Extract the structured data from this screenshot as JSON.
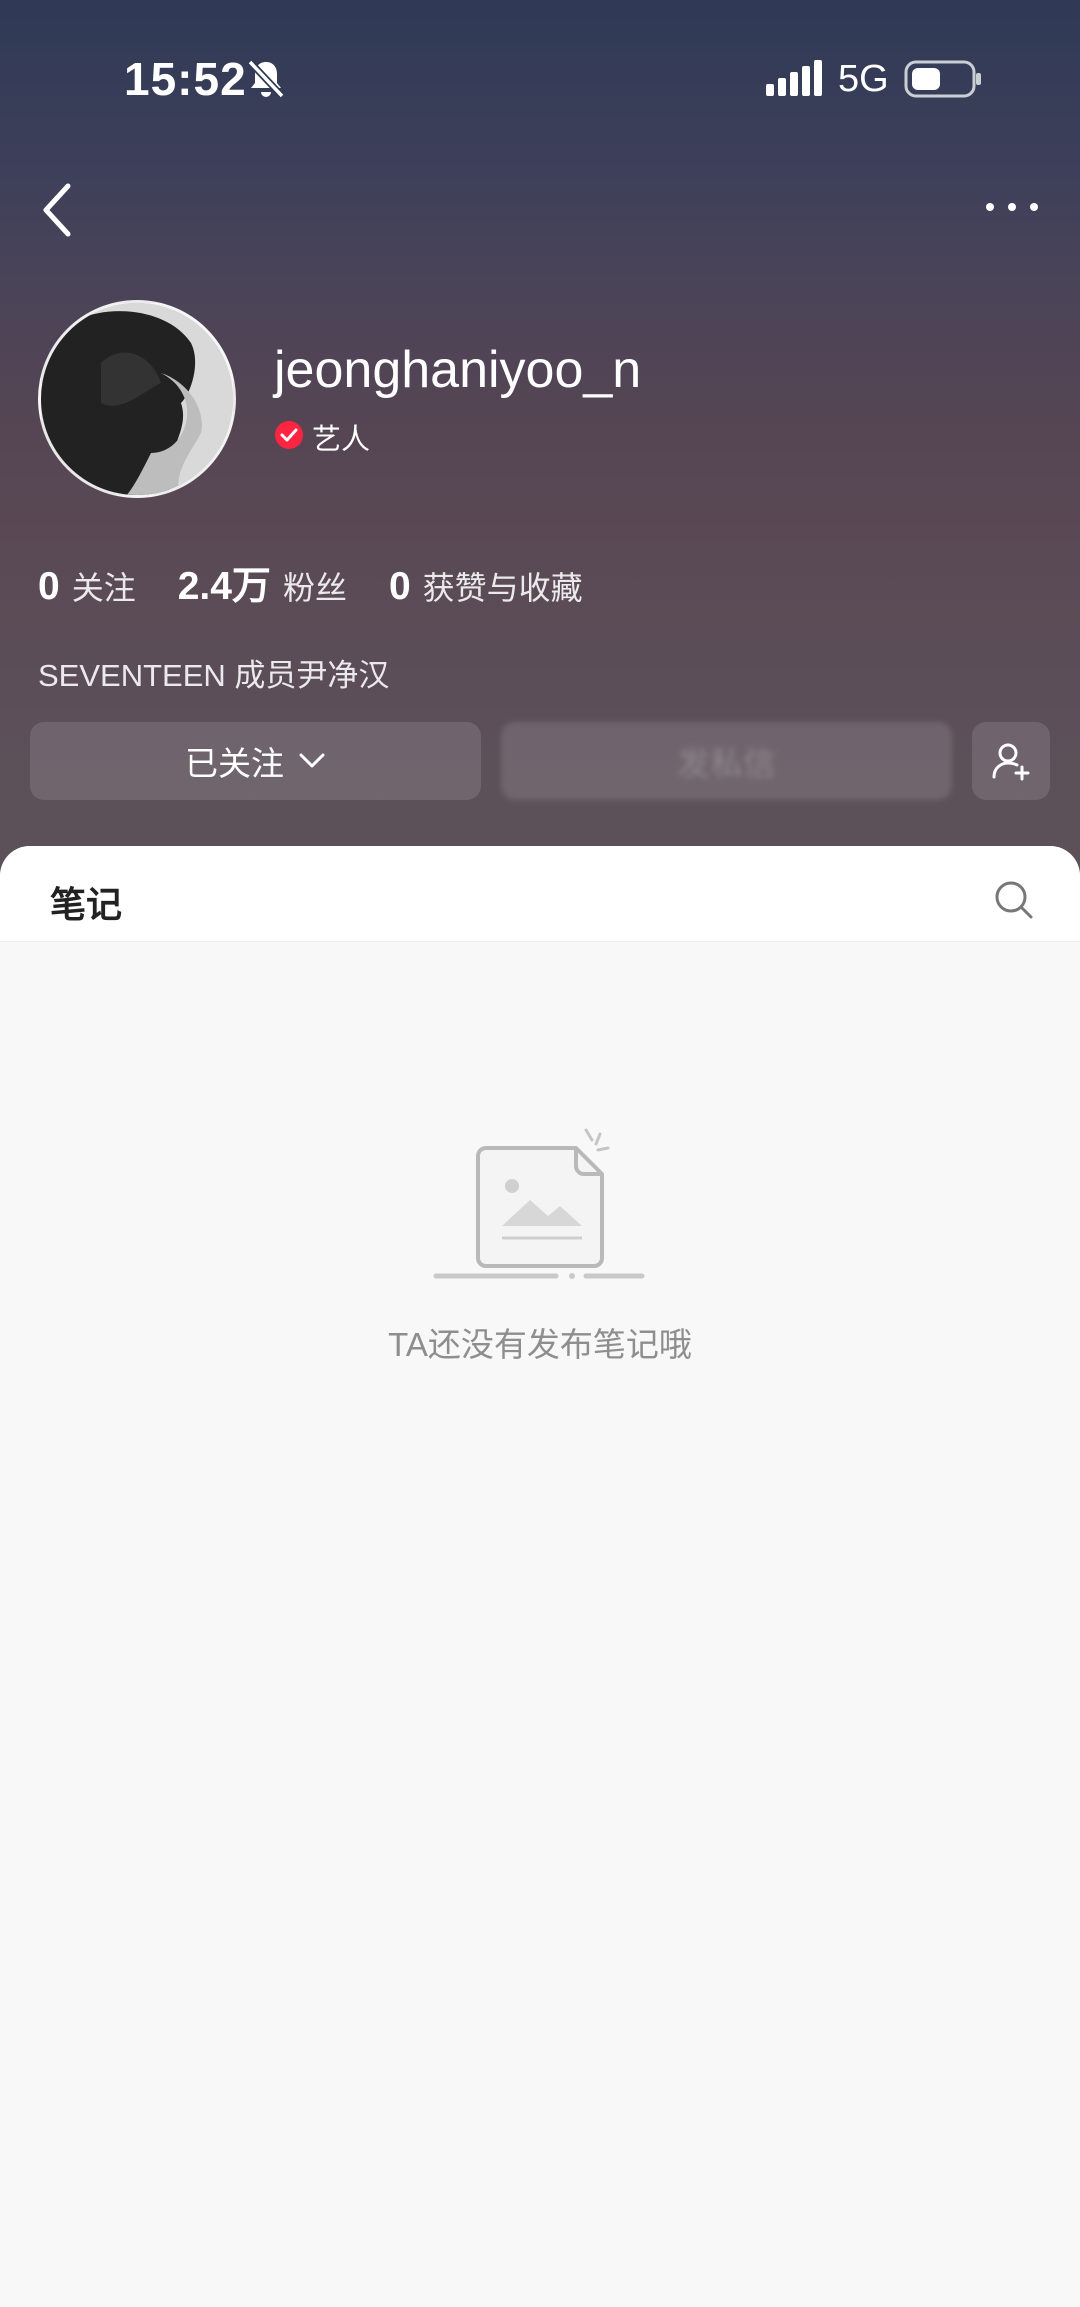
{
  "status_bar": {
    "time": "15:52",
    "network": "5G"
  },
  "profile": {
    "username": "jeonghaniyoo_n",
    "verified_label": "艺人",
    "bio": "SEVENTEEN 成员尹净汉"
  },
  "stats": [
    {
      "value": "0",
      "label": "关注"
    },
    {
      "value": "2.4万",
      "label": "粉丝"
    },
    {
      "value": "0",
      "label": "获赞与收藏"
    }
  ],
  "actions": {
    "follow_label": "已关注",
    "message_label": "发私信"
  },
  "tabs": {
    "notes_label": "笔记"
  },
  "empty_state": {
    "text": "TA还没有发布笔记哦"
  },
  "colors": {
    "verified": "#ff2442",
    "header_top": "#2f3a55",
    "header_bottom": "#5d5259"
  },
  "icons": [
    "bell-muted-icon",
    "signal-icon",
    "battery-icon",
    "back-icon",
    "more-icon",
    "verified-icon",
    "chevron-down-icon",
    "add-user-icon",
    "search-icon",
    "empty-note-icon"
  ]
}
